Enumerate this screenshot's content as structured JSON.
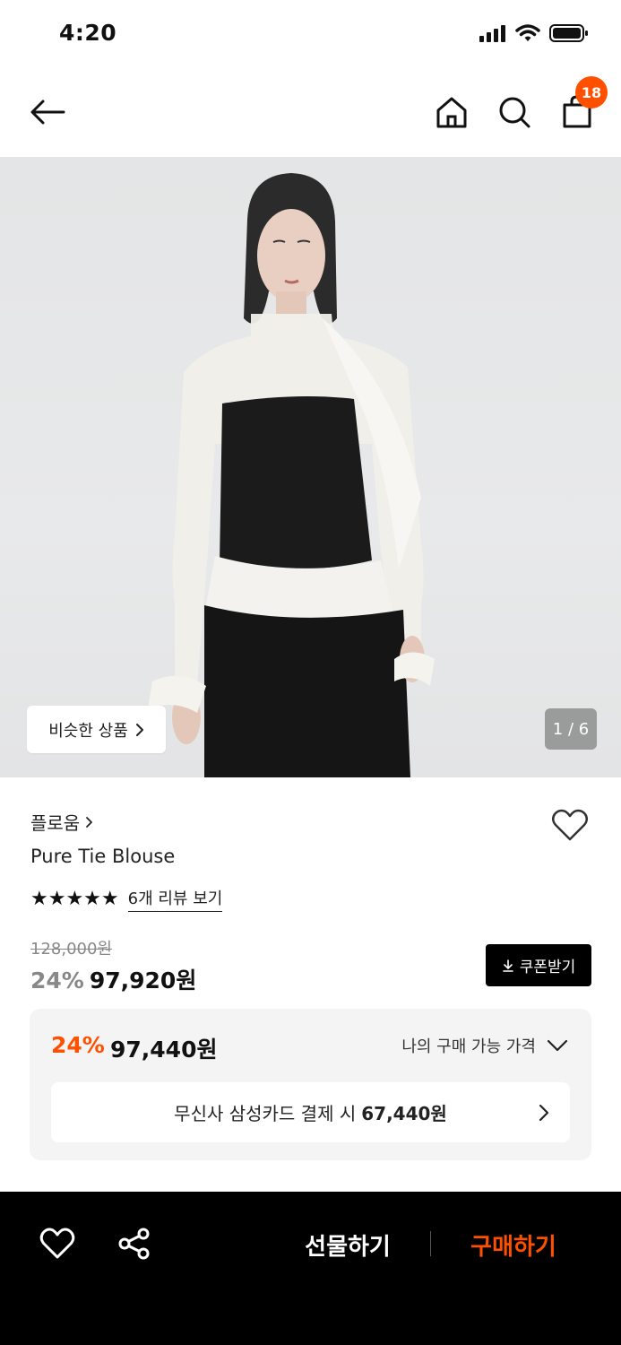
{
  "status_bar": {
    "time": "4:20"
  },
  "header": {
    "cart_count": "18"
  },
  "hero": {
    "similar_label": "비슷한 상품",
    "page_indicator": "1 / 6"
  },
  "product": {
    "brand": "플로움",
    "name": "Pure Tie Blouse",
    "rating_stars": 5,
    "review_label": "6개 리뷰 보기",
    "original_price": "128,000원",
    "discount": "24%",
    "price": "97,920원",
    "coupon_label": "쿠폰받기"
  },
  "my_price": {
    "discount": "24%",
    "price": "97,440원",
    "toggle_label": "나의 구매 가능 가격",
    "card_offer_text": "무신사 삼성카드 결제 시",
    "card_offer_price": "67,440원"
  },
  "bottom_bar": {
    "gift_label": "선물하기",
    "buy_label": "구매하기"
  },
  "colors": {
    "accent": "#ff5000",
    "dark": "#000000",
    "gray_text": "#888888",
    "panel_bg": "#f4f4f4"
  }
}
